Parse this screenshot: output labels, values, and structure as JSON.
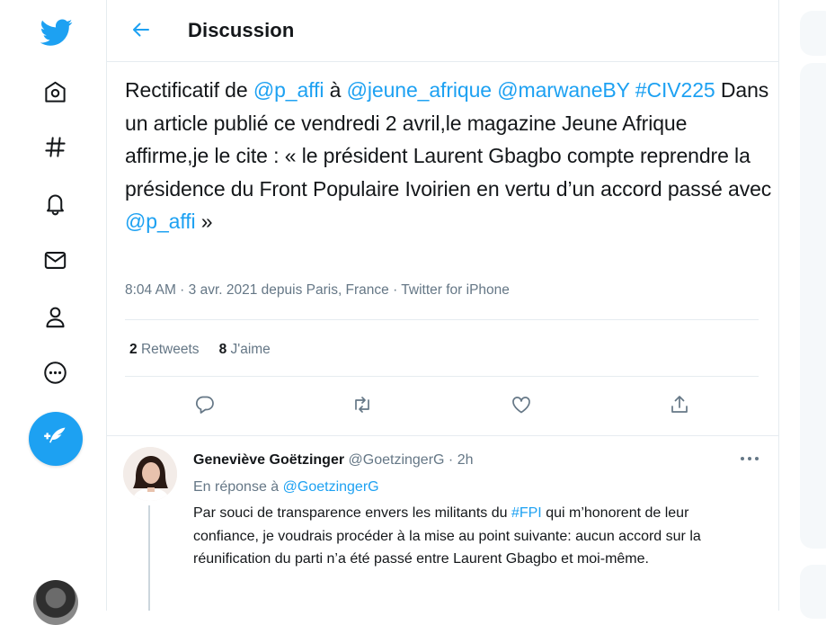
{
  "colors": {
    "accent": "#1da1f2",
    "secondary_text": "#657786",
    "border": "#e6ecf0"
  },
  "nav": {
    "items": [
      {
        "name": "twitter-logo",
        "icon": "twitter-bird-icon"
      },
      {
        "name": "home",
        "icon": "home-icon"
      },
      {
        "name": "explore",
        "icon": "hashtag-icon"
      },
      {
        "name": "notifications",
        "icon": "bell-icon"
      },
      {
        "name": "messages",
        "icon": "envelope-icon"
      },
      {
        "name": "profile",
        "icon": "person-icon"
      },
      {
        "name": "more",
        "icon": "more-circle-icon"
      }
    ],
    "compose_icon": "feather-plus-icon"
  },
  "header": {
    "title": "Discussion",
    "back_icon": "arrow-left-icon"
  },
  "tweet": {
    "text_1": "Rectificatif de ",
    "mention_1": "@p_affi",
    "text_2": " à ",
    "mention_2": "@jeune_afrique",
    "text_3": " ",
    "mention_3": "@marwaneBY",
    "text_4": " ",
    "hashtag_1": "#CIV225",
    "text_5": " Dans un article publié ce vendredi 2 avril,le magazine Jeune Afrique affirme,je le cite : « le président Laurent Gbagbo compte reprendre la présidence du Front Populaire Ivoirien en vertu d’un accord passé avec ",
    "mention_4": "@p_affi",
    "text_6": " »",
    "meta": "8:04 AM · 3 avr. 2021 depuis Paris, France · Twitter for iPhone",
    "retweets_count": "2",
    "retweets_label": "Retweets",
    "likes_count": "8",
    "likes_label": "J'aime"
  },
  "reply": {
    "author_name": "Geneviève Goëtzinger",
    "author_handle": "@GoetzingerG",
    "separator": "·",
    "time": "2h",
    "reply_prefix": "En réponse à",
    "reply_handle": "@GoetzingerG",
    "text_1": "Par souci de transparence envers les militants du ",
    "hashtag": "#FPI",
    "text_2": " qui m’honorent de leur confiance, je voudrais procéder à la mise au point suivante: aucun accord sur la réunification du parti n’a été passé entre Laurent Gbagbo et moi-même."
  }
}
